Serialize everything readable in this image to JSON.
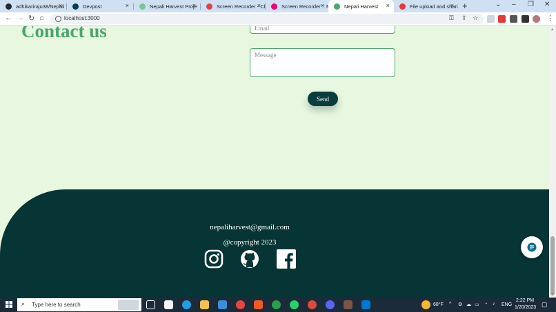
{
  "browser": {
    "tabs": [
      {
        "title": "adhikariraju38/Nepali",
        "color": "#24292f"
      },
      {
        "title": "Devpost",
        "color": "#003e54"
      },
      {
        "title": "Nepali Harvest Proje",
        "color": "#7cc495"
      },
      {
        "title": "Screen Recorder - Ch",
        "color": "#d44"
      },
      {
        "title": "Screen Recorder :: M",
        "color": "#e07"
      },
      {
        "title": "Nepali Harvest",
        "color": "#4aa56b"
      },
      {
        "title": "File upload and shari",
        "color": "#e53935"
      }
    ],
    "close_glyph": "×",
    "new_tab_glyph": "+",
    "url": "localhost:3000"
  },
  "page": {
    "title": "Contact us",
    "email_placeholder": "Email",
    "message_placeholder": "Message",
    "send_label": "Send"
  },
  "footer": {
    "email": "nepaliharvest@gmail.com",
    "copyright": "@copyright 2023",
    "social": [
      "instagram-icon",
      "github-icon",
      "facebook-icon"
    ]
  },
  "taskbar": {
    "search_placeholder": "Type here to search",
    "weather": "68°F",
    "language": "ENG",
    "time": "2:22 PM",
    "date": "1/20/2023"
  }
}
